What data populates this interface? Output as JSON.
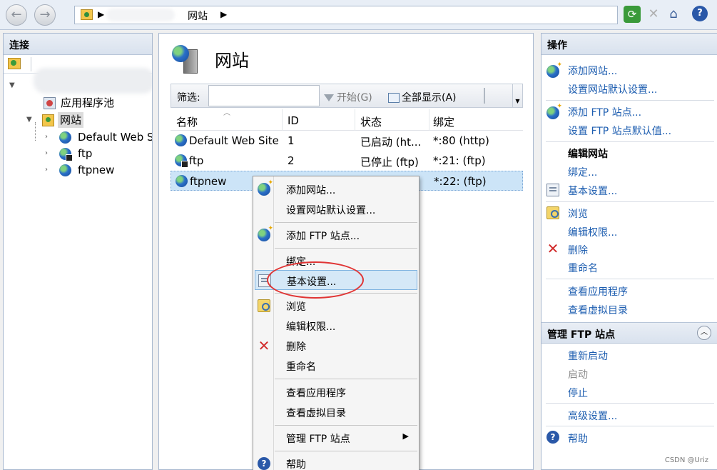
{
  "address": {
    "location": "网站"
  },
  "left_panel": {
    "title": "连接",
    "tree": {
      "app_pools": "应用程序池",
      "sites": "网站",
      "site_items": [
        "Default Web S",
        "ftp",
        "ftpnew"
      ]
    }
  },
  "center": {
    "title": "网站",
    "filter": {
      "label": "筛选:",
      "placeholder": "",
      "start": "开始(G)",
      "show_all": "全部显示(A)"
    },
    "columns": [
      "名称",
      "ID",
      "状态",
      "绑定"
    ],
    "rows": [
      {
        "name": "Default Web Site",
        "id": "1",
        "state": "已启动 (ht...",
        "binding": "*:80 (http)"
      },
      {
        "name": "ftp",
        "id": "2",
        "state": "已停止 (ftp)",
        "binding": "*:21: (ftp)"
      },
      {
        "name": "ftpnew",
        "id": "",
        "state": "",
        "binding": "*:22: (ftp)"
      }
    ]
  },
  "context_menu": {
    "items": [
      "添加网站...",
      "设置网站默认设置...",
      "添加 FTP 站点...",
      "绑定...",
      "基本设置...",
      "浏览",
      "编辑权限...",
      "删除",
      "重命名",
      "查看应用程序",
      "查看虚拟目录",
      "管理 FTP 站点",
      "帮助"
    ],
    "highlighted": "基本设置..."
  },
  "right_panel": {
    "title": "操作",
    "actions": {
      "add_site": "添加网站...",
      "site_defaults": "设置网站默认设置...",
      "add_ftp": "添加 FTP 站点...",
      "ftp_defaults": "设置 FTP 站点默认值...",
      "edit_site": "编辑网站",
      "bindings": "绑定...",
      "basic_settings": "基本设置...",
      "browse": "浏览",
      "edit_permissions": "编辑权限...",
      "delete": "删除",
      "rename": "重命名",
      "view_apps": "查看应用程序",
      "view_vdirs": "查看虚拟目录"
    },
    "manage_ftp": {
      "title": "管理 FTP 站点",
      "restart": "重新启动",
      "start": "启动",
      "stop": "停止",
      "advanced": "高级设置...",
      "help": "帮助"
    }
  },
  "watermark": "CSDN @Uriz",
  "colors": {
    "link": "#1e5eb0",
    "selection": "#cce4f7",
    "highlight_ring": "#e03434"
  }
}
